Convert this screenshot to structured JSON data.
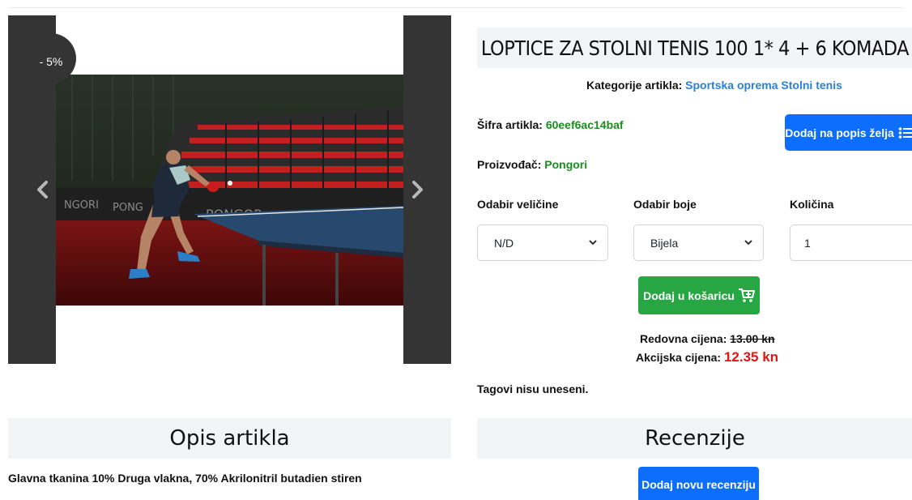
{
  "carousel": {
    "discount_badge": "- 5%",
    "image_icon": "table-tennis-player-photo",
    "prev_icon": "chevron-left-icon",
    "next_icon": "chevron-right-icon"
  },
  "product": {
    "title": "LOPTICE ZA STOLNI TENIS 100 1* 4 + 6 KOMADA",
    "categories_label": "Kategorije artikla:",
    "category_1": "Sportska oprema",
    "category_2": "Stolni tenis",
    "sku_label": "Šifra artikla:",
    "sku_value": "60eef6ac14baf",
    "manufacturer_label": "Proizvođač:",
    "manufacturer_value": "Pongori",
    "wishlist_button": "Dodaj na popis želja",
    "size_label": "Odabir veličine",
    "size_selected": "N/D",
    "color_label": "Odabir boje",
    "color_selected": "Bijela",
    "quantity_label": "Količina",
    "quantity_value": "1",
    "add_to_cart_button": "Dodaj u košaricu",
    "regular_price_label": "Redovna cijena:",
    "regular_price_value": "13.00 kn",
    "sale_price_label": "Akcijska cijena:",
    "sale_price_value": "12.35 kn",
    "tags_text": "Tagovi nisu uneseni."
  },
  "description": {
    "heading": "Opis artikla",
    "text": "Glavna tkanina 10% Druga vlakna, 70% Akrilonitril butadien stiren"
  },
  "reviews": {
    "heading": "Recenzije",
    "add_review_button": "Dodaj novu recenziju"
  },
  "colors": {
    "primary": "#0d6efd",
    "success": "#27a744",
    "sku_green": "#198d1e",
    "sale_red": "#e01515",
    "link_blue": "#2a80d8",
    "carousel_dark": "#343434"
  }
}
